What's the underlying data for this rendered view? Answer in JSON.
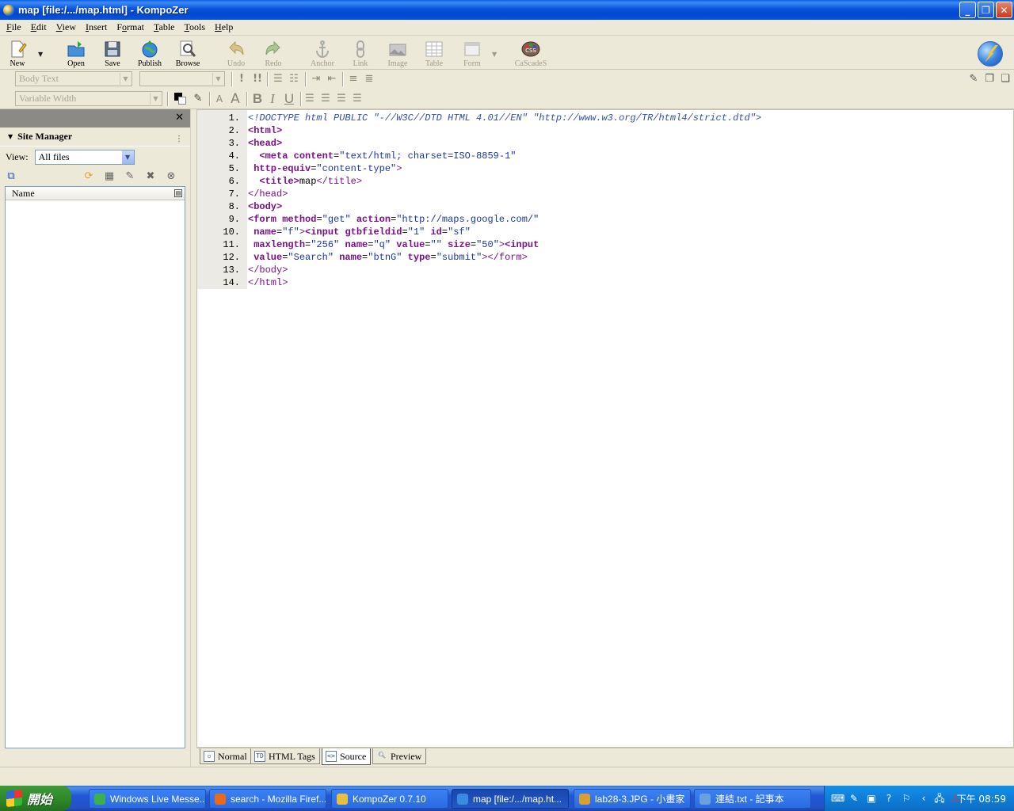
{
  "window": {
    "title": "map [file:/.../map.html] - KompoZer"
  },
  "menu": [
    {
      "label": "File",
      "key": "F"
    },
    {
      "label": "Edit",
      "key": "E"
    },
    {
      "label": "View",
      "key": "V"
    },
    {
      "label": "Insert",
      "key": "I"
    },
    {
      "label": "Format",
      "key": "o"
    },
    {
      "label": "Table",
      "key": "T"
    },
    {
      "label": "Tools",
      "key": "T"
    },
    {
      "label": "Help",
      "key": "H"
    }
  ],
  "toolbar": {
    "new": "New",
    "open": "Open",
    "save": "Save",
    "publish": "Publish",
    "browse": "Browse",
    "undo": "Undo",
    "redo": "Redo",
    "anchor": "Anchor",
    "link": "Link",
    "image": "Image",
    "table": "Table",
    "form": "Form",
    "cascades": "CaScadeS"
  },
  "format": {
    "paragraph_style": "Body Text",
    "font_value": "",
    "font_family": "Variable Width"
  },
  "sidebar": {
    "title": "Site Manager",
    "view_label": "View:",
    "view_value": "All files",
    "column_name": "Name"
  },
  "editor": {
    "lines": [
      {
        "n": "1.",
        "parts": [
          [
            "doc",
            "<!DOCTYPE html PUBLIC \"-//W3C//DTD HTML 4.01//EN\" \"http://www.w3.org/TR/html4/strict.dtd\">"
          ]
        ]
      },
      {
        "n": "2.",
        "parts": [
          [
            "tag",
            "<html>"
          ]
        ]
      },
      {
        "n": "3.",
        "parts": [
          [
            "tag",
            "<head>"
          ]
        ]
      },
      {
        "n": "4.",
        "parts": [
          [
            "txt",
            "  "
          ],
          [
            "tag",
            "<meta"
          ],
          [
            "txt",
            " "
          ],
          [
            "attr",
            "content"
          ],
          [
            "txt",
            "="
          ],
          [
            "val",
            "\"text/html; charset=ISO-8859-1\""
          ]
        ]
      },
      {
        "n": "5.",
        "parts": [
          [
            "txt",
            " "
          ],
          [
            "attr",
            "http-equiv"
          ],
          [
            "txt",
            "="
          ],
          [
            "val",
            "\"content-type\""
          ],
          [
            "tagc",
            ">"
          ]
        ]
      },
      {
        "n": "6.",
        "parts": [
          [
            "txt",
            "  "
          ],
          [
            "tag",
            "<title>"
          ],
          [
            "txt",
            "map"
          ],
          [
            "tagc",
            "</title>"
          ]
        ]
      },
      {
        "n": "7.",
        "parts": [
          [
            "tagc",
            "</head>"
          ]
        ]
      },
      {
        "n": "8.",
        "parts": [
          [
            "tag",
            "<body>"
          ]
        ]
      },
      {
        "n": "9.",
        "parts": [
          [
            "tag",
            "<form"
          ],
          [
            "txt",
            " "
          ],
          [
            "attr",
            "method"
          ],
          [
            "txt",
            "="
          ],
          [
            "val",
            "\"get\""
          ],
          [
            "txt",
            " "
          ],
          [
            "attr",
            "action"
          ],
          [
            "txt",
            "="
          ],
          [
            "val",
            "\"http://maps.google.com/\""
          ]
        ]
      },
      {
        "n": "10.",
        "parts": [
          [
            "txt",
            " "
          ],
          [
            "attr",
            "name"
          ],
          [
            "txt",
            "="
          ],
          [
            "val",
            "\"f\""
          ],
          [
            "tagc",
            ">"
          ],
          [
            "tag",
            "<input"
          ],
          [
            "txt",
            " "
          ],
          [
            "attr",
            "gtbfieldid"
          ],
          [
            "txt",
            "="
          ],
          [
            "val",
            "\"1\""
          ],
          [
            "txt",
            " "
          ],
          [
            "attr",
            "id"
          ],
          [
            "txt",
            "="
          ],
          [
            "val",
            "\"sf\""
          ]
        ]
      },
      {
        "n": "11.",
        "parts": [
          [
            "txt",
            " "
          ],
          [
            "attr",
            "maxlength"
          ],
          [
            "txt",
            "="
          ],
          [
            "val",
            "\"256\""
          ],
          [
            "txt",
            " "
          ],
          [
            "attr",
            "name"
          ],
          [
            "txt",
            "="
          ],
          [
            "val",
            "\"q\""
          ],
          [
            "txt",
            " "
          ],
          [
            "attr",
            "value"
          ],
          [
            "txt",
            "="
          ],
          [
            "val",
            "\"\""
          ],
          [
            "txt",
            " "
          ],
          [
            "attr",
            "size"
          ],
          [
            "txt",
            "="
          ],
          [
            "val",
            "\"50\""
          ],
          [
            "tagc",
            ">"
          ],
          [
            "tag",
            "<input"
          ]
        ]
      },
      {
        "n": "12.",
        "parts": [
          [
            "txt",
            " "
          ],
          [
            "attr",
            "value"
          ],
          [
            "txt",
            "="
          ],
          [
            "val",
            "\"Search\""
          ],
          [
            "txt",
            " "
          ],
          [
            "attr",
            "name"
          ],
          [
            "txt",
            "="
          ],
          [
            "val",
            "\"btnG\""
          ],
          [
            "txt",
            " "
          ],
          [
            "attr",
            "type"
          ],
          [
            "txt",
            "="
          ],
          [
            "val",
            "\"submit\""
          ],
          [
            "tagc",
            ">"
          ],
          [
            "tagc",
            "</form>"
          ]
        ]
      },
      {
        "n": "13.",
        "parts": [
          [
            "tagc",
            "</body>"
          ]
        ]
      },
      {
        "n": "14.",
        "parts": [
          [
            "tagc",
            "</html>"
          ]
        ]
      }
    ]
  },
  "mode_tabs": {
    "normal": "Normal",
    "html_tags": "HTML Tags",
    "source": "Source",
    "preview": "Preview",
    "active": "Source"
  },
  "taskbar": {
    "start": "開始",
    "tasks": [
      "Windows Live Messe...",
      "search - Mozilla Firef...",
      "KompoZer 0.7.10",
      "map [file:/.../map.ht...",
      "lab28-3.JPG - 小畫家",
      "連結.txt - 記事本"
    ],
    "active_task": "map [file:/.../map.ht...",
    "clock": "下午 08:59"
  },
  "colors": {
    "titlebar": "#0A5FE3",
    "chrome": "#ECE9D8",
    "tag": "#7A1088",
    "value": "#1A38A8",
    "doctype": "#3050A8",
    "start_button": "#2F8A2A"
  }
}
